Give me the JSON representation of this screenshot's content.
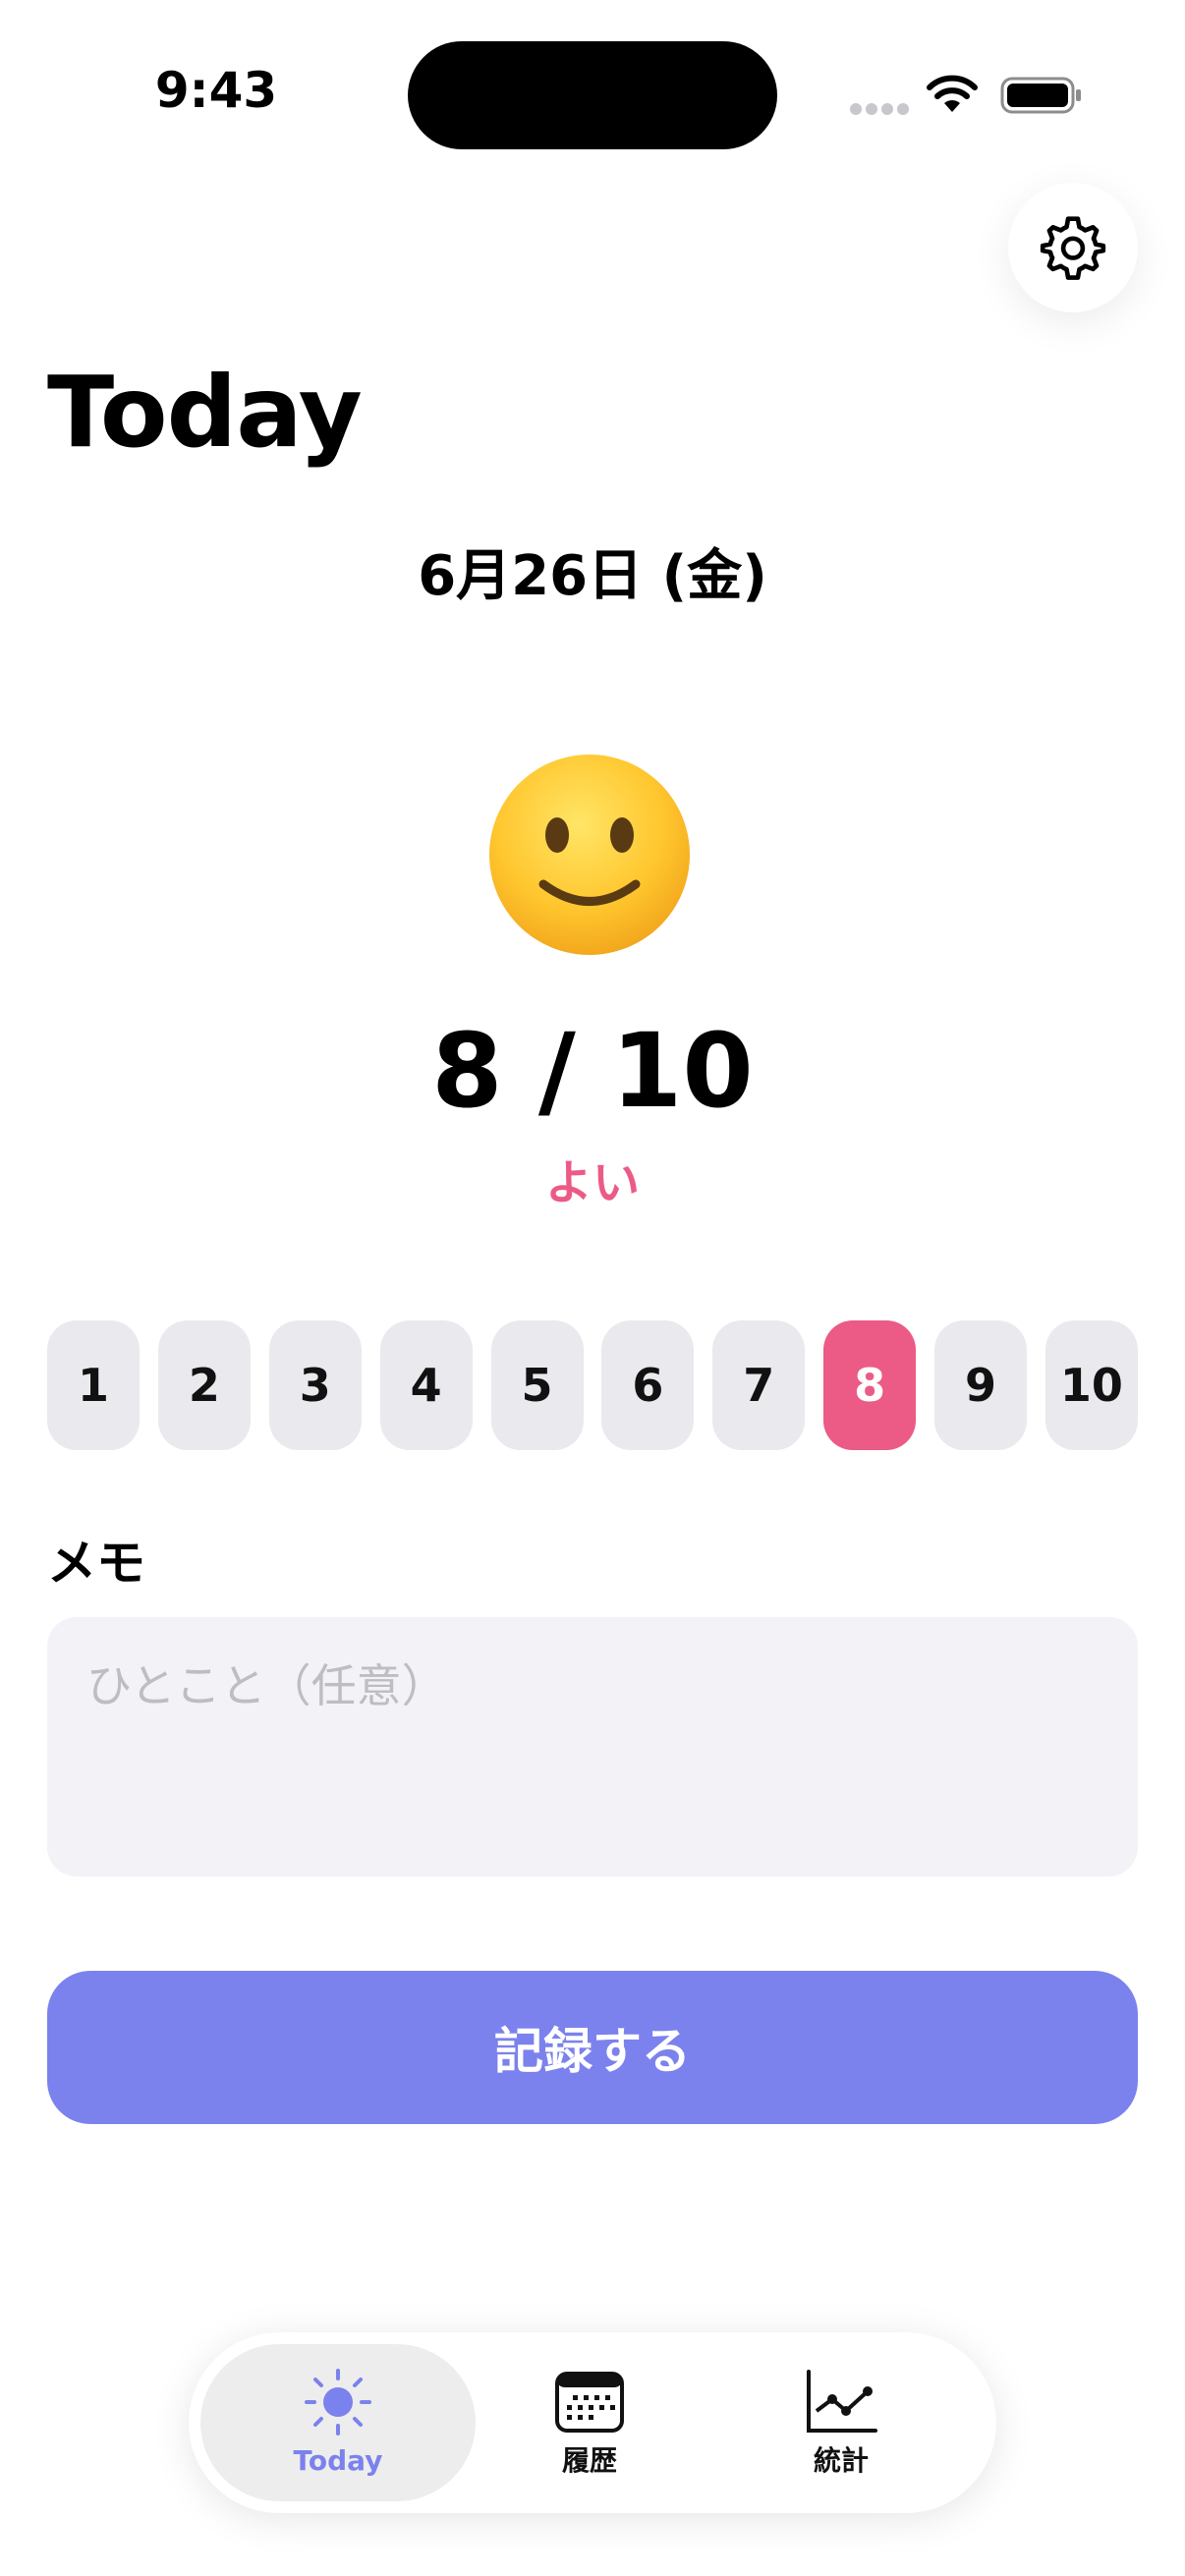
{
  "status_bar": {
    "time": "9:43"
  },
  "header": {
    "title": "Today",
    "settings_icon": "gear-icon"
  },
  "entry": {
    "date": "6月26日 (金)",
    "face_icon": "slightly-smiling-face-icon",
    "score_text": "8 / 10",
    "score_value": 8,
    "score_max": 10,
    "mood_label": "よい"
  },
  "score_options": [
    "1",
    "2",
    "3",
    "4",
    "5",
    "6",
    "7",
    "8",
    "9",
    "10"
  ],
  "selected_score": "8",
  "memo": {
    "label": "メモ",
    "value": "",
    "placeholder": "ひとこと（任意）"
  },
  "save_button": {
    "label": "記録する"
  },
  "tab_bar": {
    "tabs": [
      {
        "label": "Today",
        "icon": "sun-icon",
        "active": true
      },
      {
        "label": "履歴",
        "icon": "calendar-icon",
        "active": false
      },
      {
        "label": "統計",
        "icon": "line-chart-icon",
        "active": false
      }
    ]
  },
  "colors": {
    "accent": "#7B82ED",
    "selected_score": "#EB5B85",
    "chip_background": "#E9E9EE",
    "memo_background": "#F2F2F7"
  }
}
